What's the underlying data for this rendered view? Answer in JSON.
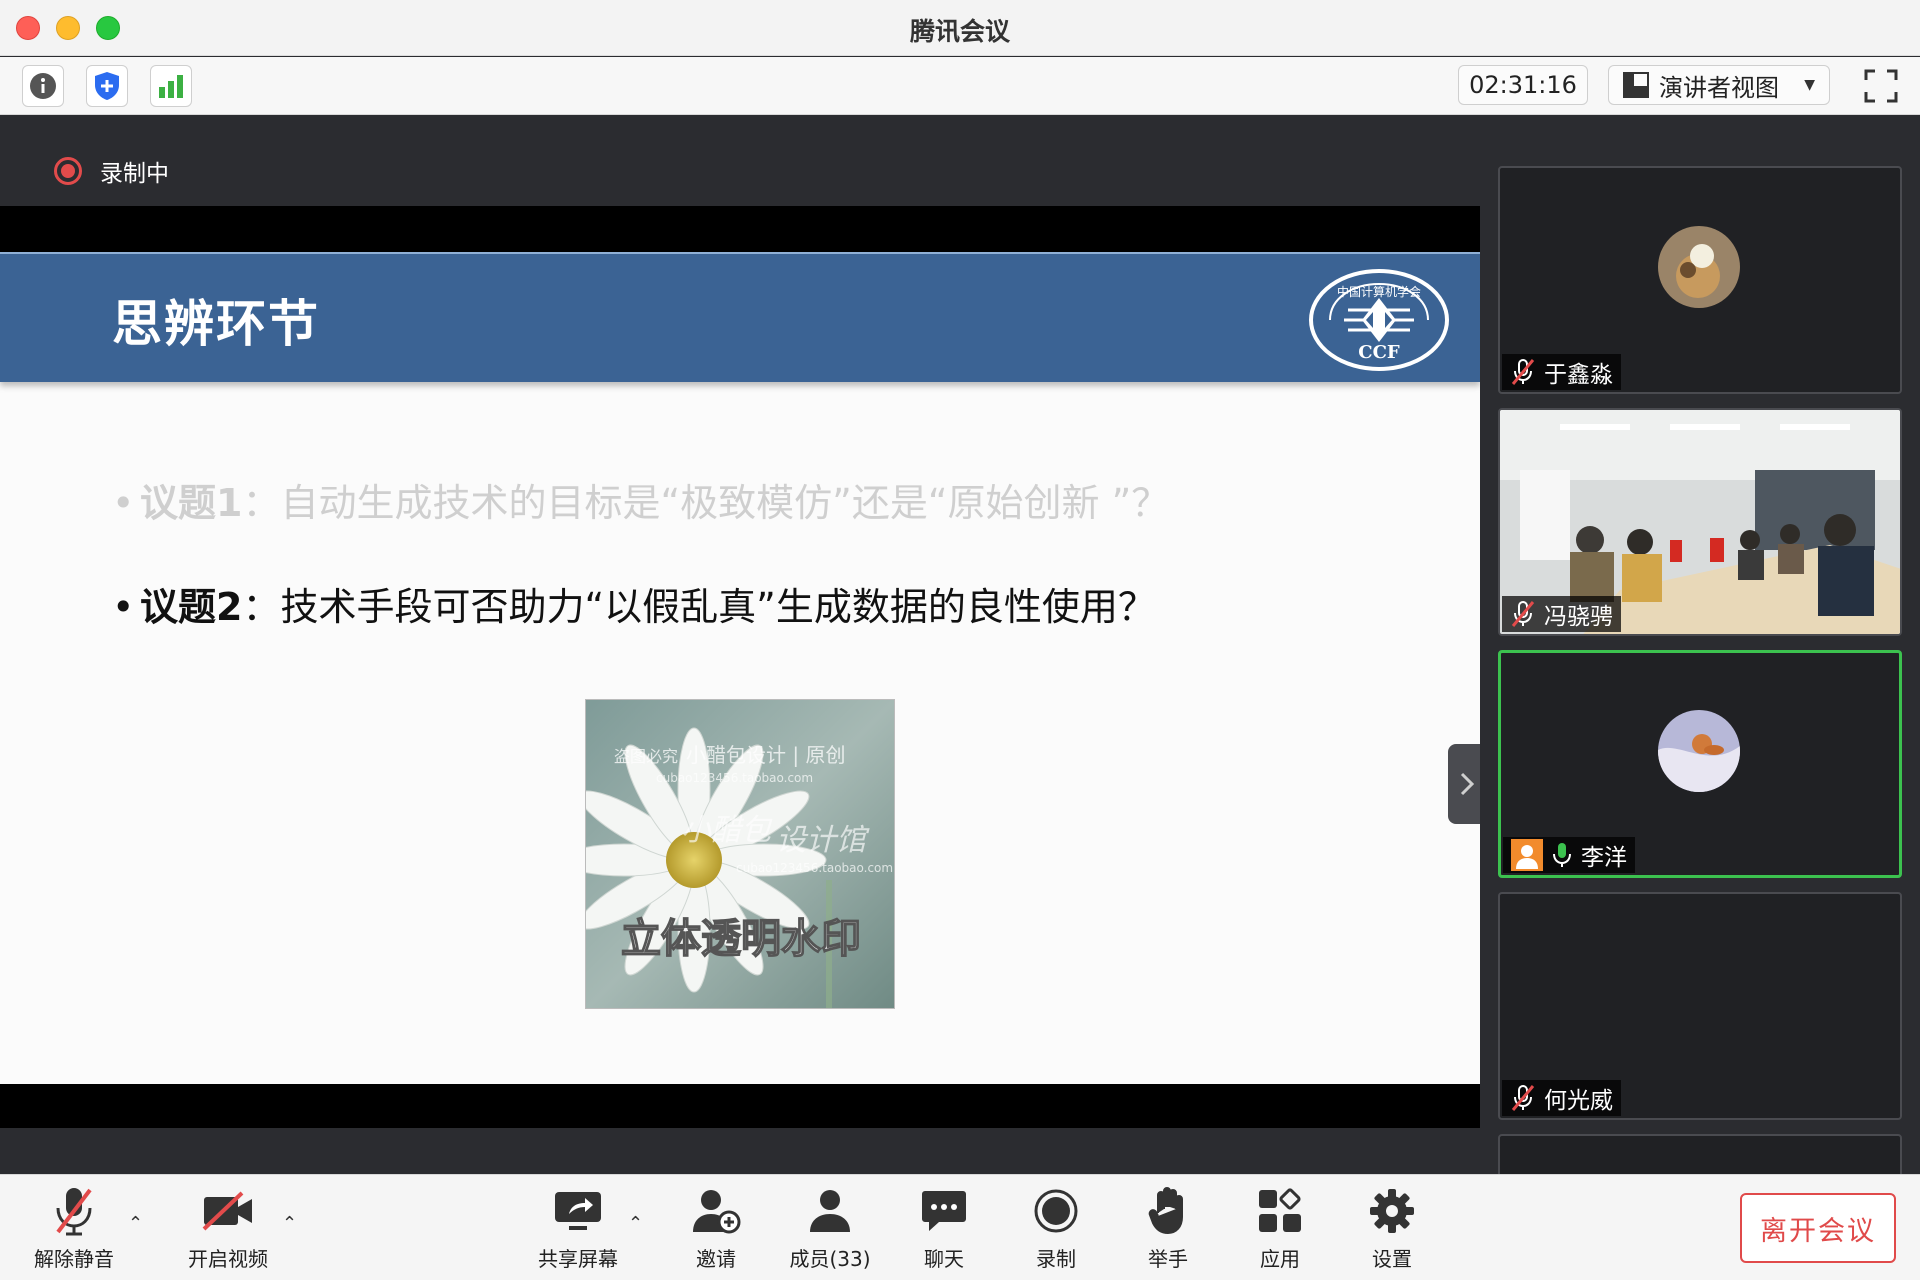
{
  "window": {
    "title": "腾讯会议"
  },
  "toolbar": {
    "timer": "02:31:16",
    "view_mode": "演讲者视图"
  },
  "recording": {
    "label": "录制中"
  },
  "slide": {
    "title": "思辨环节",
    "logo_text": "中国计算机学会",
    "logo_abbr": "CCF",
    "topics": [
      {
        "label": "议题1",
        "text": "：自动生成技术的目标是“极致模仿”还是“原始创新 ”？"
      },
      {
        "label": "议题2",
        "text": "：技术手段可否助力“以假乱真”生成数据的良性使用？"
      }
    ],
    "image": {
      "watermark_1": "盗图必究",
      "watermark_2": "小醋包设计 | 原创",
      "watermark_3": "cubao123456.taobao.com",
      "watermark_4": "小醋包",
      "watermark_5": "设计馆",
      "watermark_6": "cubao123456.taobao.com",
      "caption": "立体透明水印"
    }
  },
  "participants": [
    {
      "name": "于鑫淼",
      "mic": "muted"
    },
    {
      "name": "冯骁骋",
      "mic": "muted"
    },
    {
      "name": "李洋",
      "mic": "on",
      "speaking": true
    },
    {
      "name": "何光威",
      "mic": "muted"
    }
  ],
  "bottom": {
    "unmute": "解除静音",
    "video": "开启视频",
    "share": "共享屏幕",
    "invite": "邀请",
    "members": "成员(33)",
    "chat": "聊天",
    "record": "录制",
    "raise_hand": "举手",
    "apps": "应用",
    "settings": "设置",
    "leave": "离开会议"
  },
  "colors": {
    "slide_header": "#3b6394",
    "active_speaker": "#3cc24f",
    "leave": "#e04a4a",
    "record": "#e24b4b"
  }
}
